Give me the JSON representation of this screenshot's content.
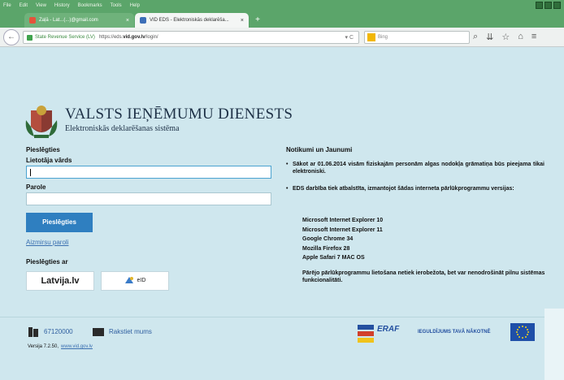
{
  "browser": {
    "menu": [
      "File",
      "Edit",
      "View",
      "History",
      "Bookmarks",
      "Tools",
      "Help"
    ],
    "tabs": [
      {
        "title": "Zaļā - Lat...(...)@gmail.com"
      },
      {
        "title": "VID EDS - Elektroniskās deklarēša..."
      }
    ],
    "url_identity": "State Revenue Service (LV)",
    "url_prefix": "https://eds.",
    "url_domain": "vid.gov.lv",
    "url_suffix": "/login/",
    "search_placeholder": "Bing"
  },
  "header": {
    "title": "VALSTS IEŅĒMUMU DIENESTS",
    "subtitle": "Elektroniskās deklarēšanas sistēma"
  },
  "login": {
    "title": "Pieslēgties",
    "username_label": "Lietotāja vārds",
    "password_label": "Parole",
    "button": "Pieslēgties",
    "forgot_link": "Aizmirsu paroli",
    "login_with": "Pieslēgties ar",
    "providers": [
      "Latvija.lv",
      "eID"
    ]
  },
  "news": {
    "title": "Notikumi un Jaunumi",
    "item1": "Sākot ar 01.06.2014 visām fiziskajām personām algas nodokļa grāmatiņa būs pieejama tikai elektroniski.",
    "item2": "EDS darbība tiek atbalstīta, izmantojot šādas interneta pārlūkprogrammu versijas:",
    "browsers": [
      "Microsoft Internet Explorer 10",
      "Microsoft Internet Explorer 11",
      "Google Chrome 34",
      "Mozilla Firefox 28",
      "Apple Safari 7 MAC OS"
    ],
    "note": "Pārējo pārlūkprogrammu lietošana netiek ierobežota, bet var nenodrošināt pilnu sistēmas funkcionalitāti."
  },
  "footer": {
    "phone": "67120000",
    "write_link": "Rakstiet mums",
    "version_label": "Versija 7.2.50,",
    "version_link": "www.vid.gov.lv",
    "eraf": "ERAF",
    "invest": "IEGULDĪJUMS TAVĀ NĀKOTNĒ"
  },
  "colors": {
    "brand": "#1e3147",
    "primary_button": "#2f7fc0",
    "background": "#cfe7ee"
  }
}
